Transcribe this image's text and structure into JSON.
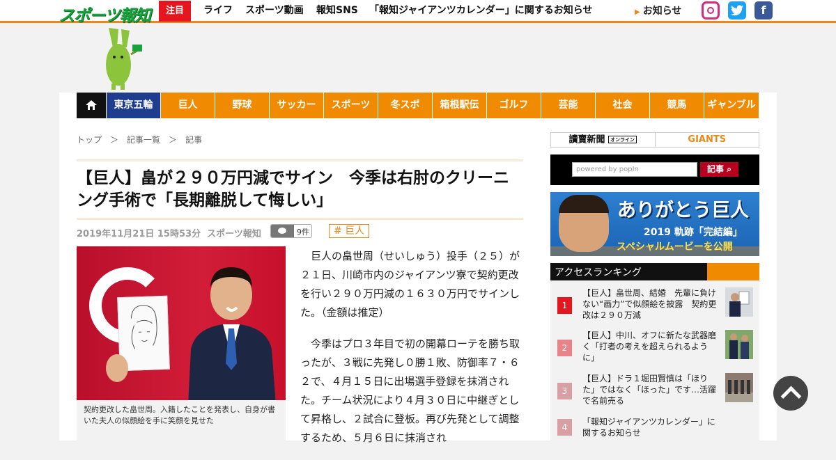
{
  "header": {
    "logo": "スポーツ報知",
    "featured_label": "注目",
    "nav": [
      "ライフ",
      "スポーツ動画",
      "報知SNS",
      "「報知ジャイアンツカレンダー」に関するお知らせ"
    ],
    "notice": "お知らせ",
    "social": [
      "instagram-icon",
      "twitter-icon",
      "facebook-icon"
    ]
  },
  "categories": [
    "東京五輪",
    "巨人",
    "野球",
    "サッカー",
    "スポーツ",
    "冬スポ",
    "箱根駅伝",
    "ゴルフ",
    "芸能",
    "社会",
    "競馬",
    "ギャンブル"
  ],
  "breadcrumb": [
    "トップ",
    "＞",
    "記事一覧",
    "＞",
    "記事"
  ],
  "article": {
    "title": "【巨人】畠が２９０万円減でサイン　今季は右肘のクリーニング手術で「長期離脱して悔しい」",
    "date": "2019年11月21日 15時53分",
    "source": "スポーツ報知",
    "comment_count": "9件",
    "tag": "# 巨人",
    "caption": "契約更改した畠世周。入籍したことを発表し、自身が書いた夫人の似顔絵を手に笑顔を見せた",
    "paragraphs": [
      "巨人の畠世周（せいしゅう）投手（２５）が２１日、川崎市内のジャイアンツ寮で契約更改を行い２９０万円減の１６３０万円でサインした。（金額は推定）",
      "今季はプロ３年目で初の開幕ローテを勝ち取ったが、３戦に先発し０勝１敗、防御率７・６２で、４月１５日に出場選手登録を抹消された。チーム状況により４月３０日に中継ぎとして昇格し、２試合に登板。再び先発として調整するため、５月６日に抹消され"
    ]
  },
  "sidebar": {
    "yomiuri": "讀賣新聞",
    "yomiuri_sub": "オンライン",
    "giants": "GIANTS",
    "search_placeholder": "powered by popIn",
    "search_button": "記事",
    "banner_title": "ありがとう巨人",
    "banner_sub": "2019 軌跡「完結編」",
    "banner_cta": "スペシャルムービーを公開",
    "ranking_title": "アクセスランキング",
    "ranking": [
      {
        "num": "1",
        "text": "【巨人】畠世周、結婚　先輩に負けない“画力”で似顔絵を披露　契約更改は２９０万減"
      },
      {
        "num": "2",
        "text": "【巨人】中川、オフに新たな武器磨く「打者の考えを超えられるように」"
      },
      {
        "num": "3",
        "text": "【巨人】ドラ１堀田賢慎は「ほりた」ではなく「ほった」です…活躍で名前売る"
      },
      {
        "num": "4",
        "text": "「報知ジャイアンツカレンダー」に関するお知らせ"
      }
    ]
  },
  "colors": {
    "accent_orange": "#f08a00",
    "rank1": "#e5161d",
    "rank2": "#e8838a",
    "rank_other": "#d9a0a4",
    "olympic_blue": "#1e3d8f"
  }
}
